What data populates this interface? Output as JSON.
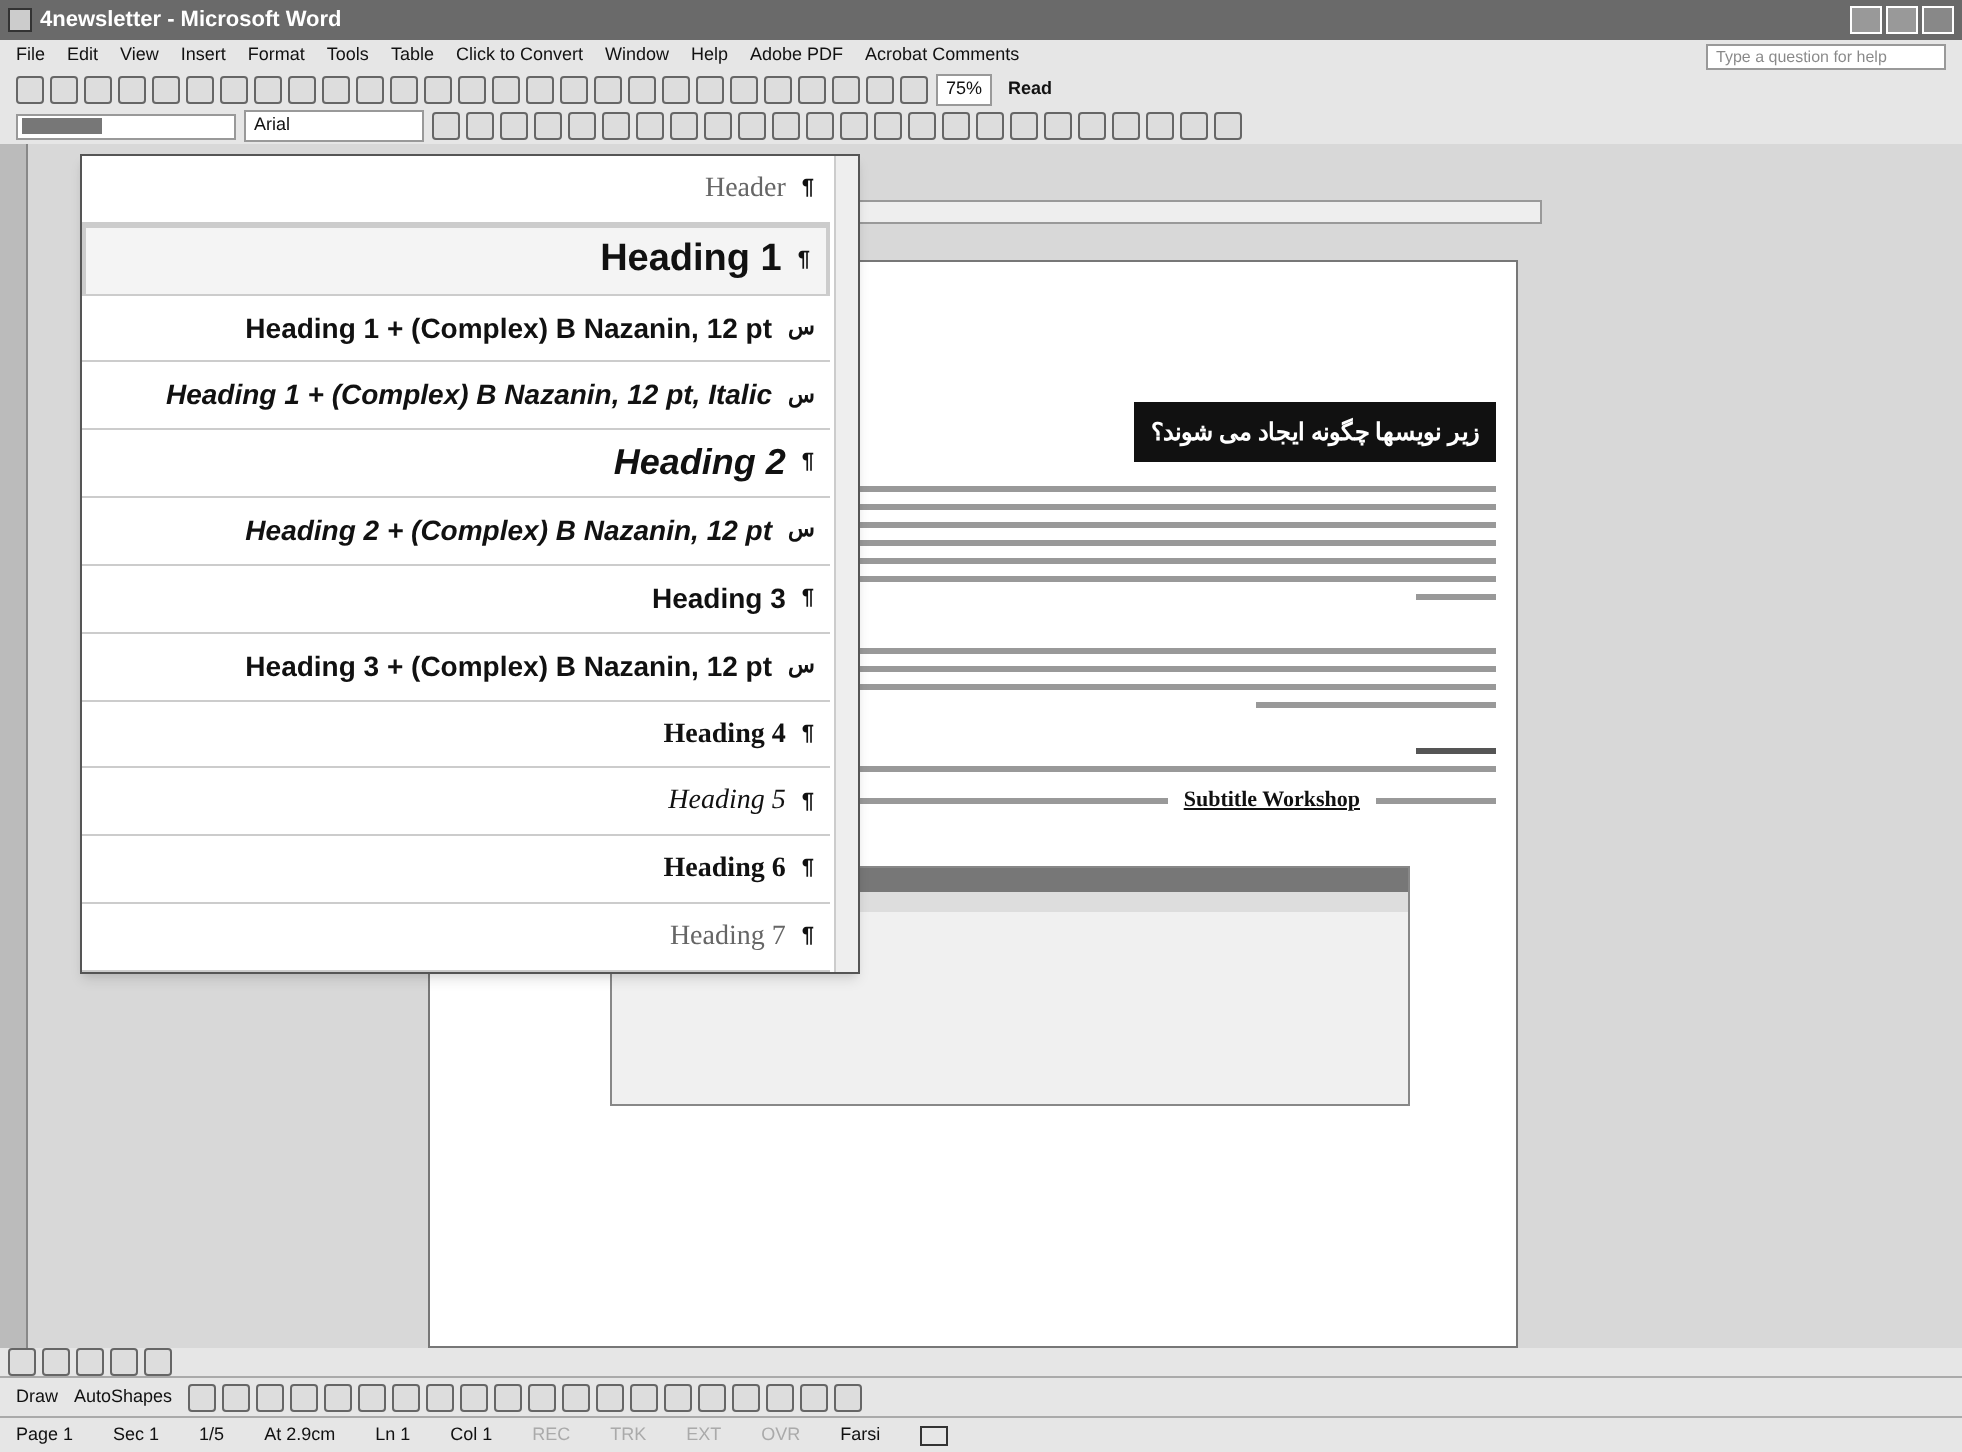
{
  "window": {
    "title": "4newsletter - Microsoft Word"
  },
  "menu": [
    "File",
    "Edit",
    "View",
    "Insert",
    "Format",
    "Tools",
    "Table",
    "Click to Convert",
    "Window",
    "Help",
    "Adobe PDF",
    "Acrobat Comments"
  ],
  "help_box": {
    "placeholder": "Type a question for help"
  },
  "standard_toolbar": {
    "zoom": "75%",
    "read": "Read"
  },
  "formatting_toolbar": {
    "font": "Arial"
  },
  "style_list": [
    {
      "label": "Header",
      "kind": "serif",
      "mark": "¶",
      "selected": false
    },
    {
      "label": "Heading 1",
      "kind": "h1",
      "mark": "¶",
      "selected": true
    },
    {
      "label": "Heading 1 + (Complex) B Nazanin, 12 pt",
      "kind": "bold",
      "mark": "س",
      "selected": false
    },
    {
      "label": "Heading 1 + (Complex) B Nazanin, 12 pt, Italic",
      "kind": "bolditalic",
      "mark": "س",
      "selected": false
    },
    {
      "label": "Heading 2",
      "kind": "h2",
      "mark": "¶",
      "selected": false
    },
    {
      "label": "Heading 2 + (Complex) B Nazanin, 12 pt",
      "kind": "bolditalic",
      "mark": "س",
      "selected": false
    },
    {
      "label": "Heading 3",
      "kind": "bold",
      "mark": "¶",
      "selected": false
    },
    {
      "label": "Heading 3 + (Complex) B Nazanin, 12 pt",
      "kind": "bold",
      "mark": "س",
      "selected": false
    },
    {
      "label": "Heading 4",
      "kind": "serifbold",
      "mark": "¶",
      "selected": false
    },
    {
      "label": "Heading 5",
      "kind": "serifitalic",
      "mark": "¶",
      "selected": false
    },
    {
      "label": "Heading 6",
      "kind": "serifbold",
      "mark": "¶",
      "selected": false
    },
    {
      "label": "Heading 7",
      "kind": "serif",
      "mark": "¶",
      "selected": false
    }
  ],
  "document": {
    "heading": "زیر نویسها چگونه ایجاد می شوند؟",
    "link": "Subtitle Workshop"
  },
  "drawing_toolbar": {
    "draw": "Draw",
    "autoshapes": "AutoShapes"
  },
  "status_bar": [
    {
      "text": "Page 1",
      "disabled": false
    },
    {
      "text": "Sec 1",
      "disabled": false
    },
    {
      "text": "1/5",
      "disabled": false
    },
    {
      "text": "At 2.9cm",
      "disabled": false
    },
    {
      "text": "Ln 1",
      "disabled": false
    },
    {
      "text": "Col 1",
      "disabled": false
    },
    {
      "text": "REC",
      "disabled": true
    },
    {
      "text": "TRK",
      "disabled": true
    },
    {
      "text": "EXT",
      "disabled": true
    },
    {
      "text": "OVR",
      "disabled": true
    },
    {
      "text": "Farsi",
      "disabled": false
    }
  ]
}
